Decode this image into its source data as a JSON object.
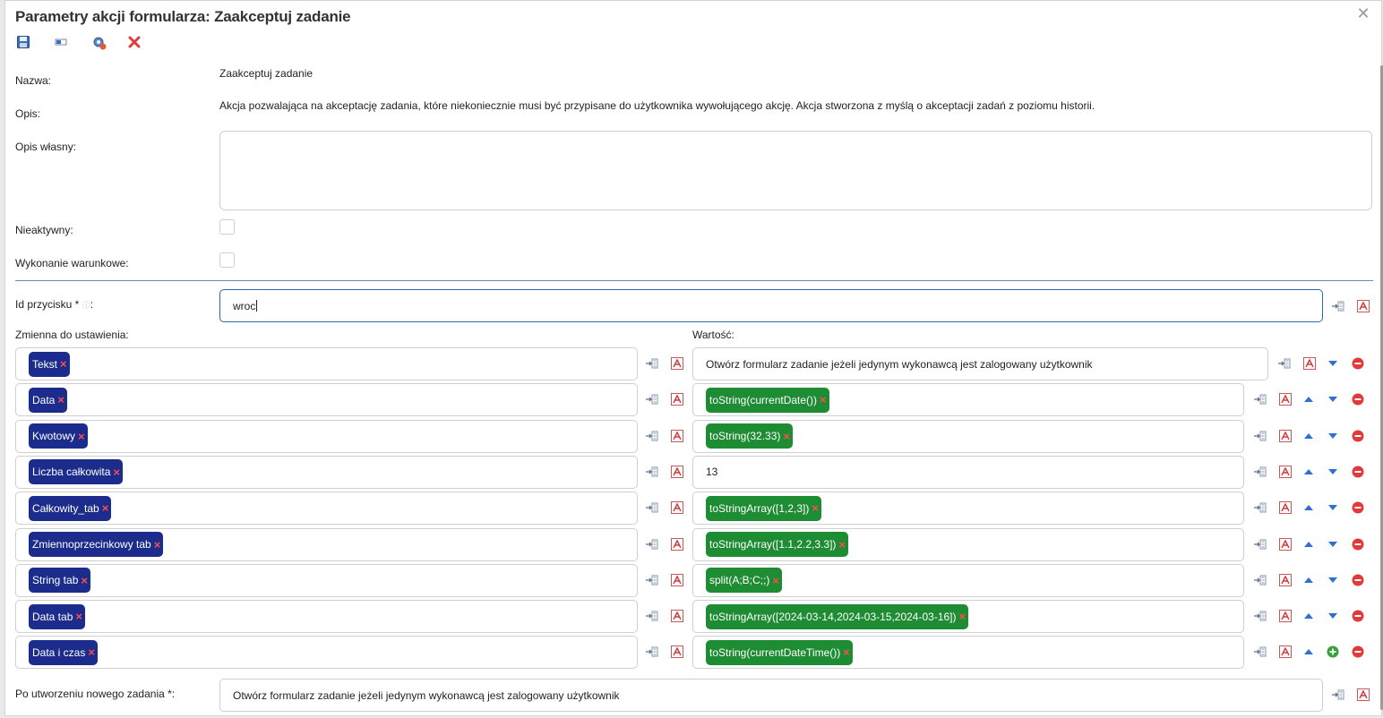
{
  "dialog": {
    "title": "Parametry akcji formularza: Zaakceptuj zadanie",
    "close_icon": "close-icon"
  },
  "toolbar": {
    "save_icon": "save-icon",
    "toggle_icon": "toggle-icon",
    "settings_icon": "settings-icon",
    "delete_icon": "delete-icon"
  },
  "form": {
    "name_label": "Nazwa:",
    "name_value": "Zaakceptuj zadanie",
    "desc_label": "Opis:",
    "desc_value": "Akcja pozwalająca na akceptację zadania, które niekoniecznie musi być przypisane do użytkownika wywołującego akcję. Akcja stworzona z myślą o akceptacji zadań z poziomu historii.",
    "own_desc_label": "Opis własny:",
    "own_desc_value": "",
    "inactive_label": "Nieaktywny:",
    "conditional_label": "Wykonanie warunkowe:",
    "button_id_label": "Id przycisku *",
    "button_id_suffix": ":",
    "button_id_value": "wroc",
    "variable_header": "Zmienna do ustawienia:",
    "value_header": "Wartość:",
    "after_create_label": "Po utworzeniu nowego zadania *:",
    "after_create_value": "Otwórz formularz zadanie jeżeli jedynym wykonawcą jest zalogowany użytkownik"
  },
  "rows": [
    {
      "variable": "Tekst",
      "value_text": "Otwórz formularz zadanie jeżeli jedynym wykonawcą jest zalogowany użytkownik",
      "value_chip": ""
    },
    {
      "variable": "Data",
      "value_text": "",
      "value_chip": "toString(currentDate())"
    },
    {
      "variable": "Kwotowy",
      "value_text": "",
      "value_chip": "toString(32.33)"
    },
    {
      "variable": "Liczba całkowita",
      "value_text": "13",
      "value_chip": ""
    },
    {
      "variable": "Całkowity_tab",
      "value_text": "",
      "value_chip": "toStringArray([1,2,3])"
    },
    {
      "variable": "Zmiennoprzecinkowy tab",
      "value_text": "",
      "value_chip": "toStringArray([1.1,2.2,3.3])"
    },
    {
      "variable": "String tab",
      "value_text": "",
      "value_chip": "split(A;B;C;;)"
    },
    {
      "variable": "Data tab",
      "value_text": "",
      "value_chip": "toStringArray([2024-03-14,2024-03-15,2024-03-16])"
    },
    {
      "variable": "Data i czas",
      "value_text": "",
      "value_chip": "toString(currentDateTime())"
    }
  ],
  "chip_remove": "×",
  "colors": {
    "chip_variable": "#1c2c8c",
    "chip_value": "#1e8c33",
    "remove_x": "#ff4d4d",
    "arrow": "#2f6fd4",
    "delete_circle": "#e03a3a",
    "add_circle": "#3aa13a"
  }
}
